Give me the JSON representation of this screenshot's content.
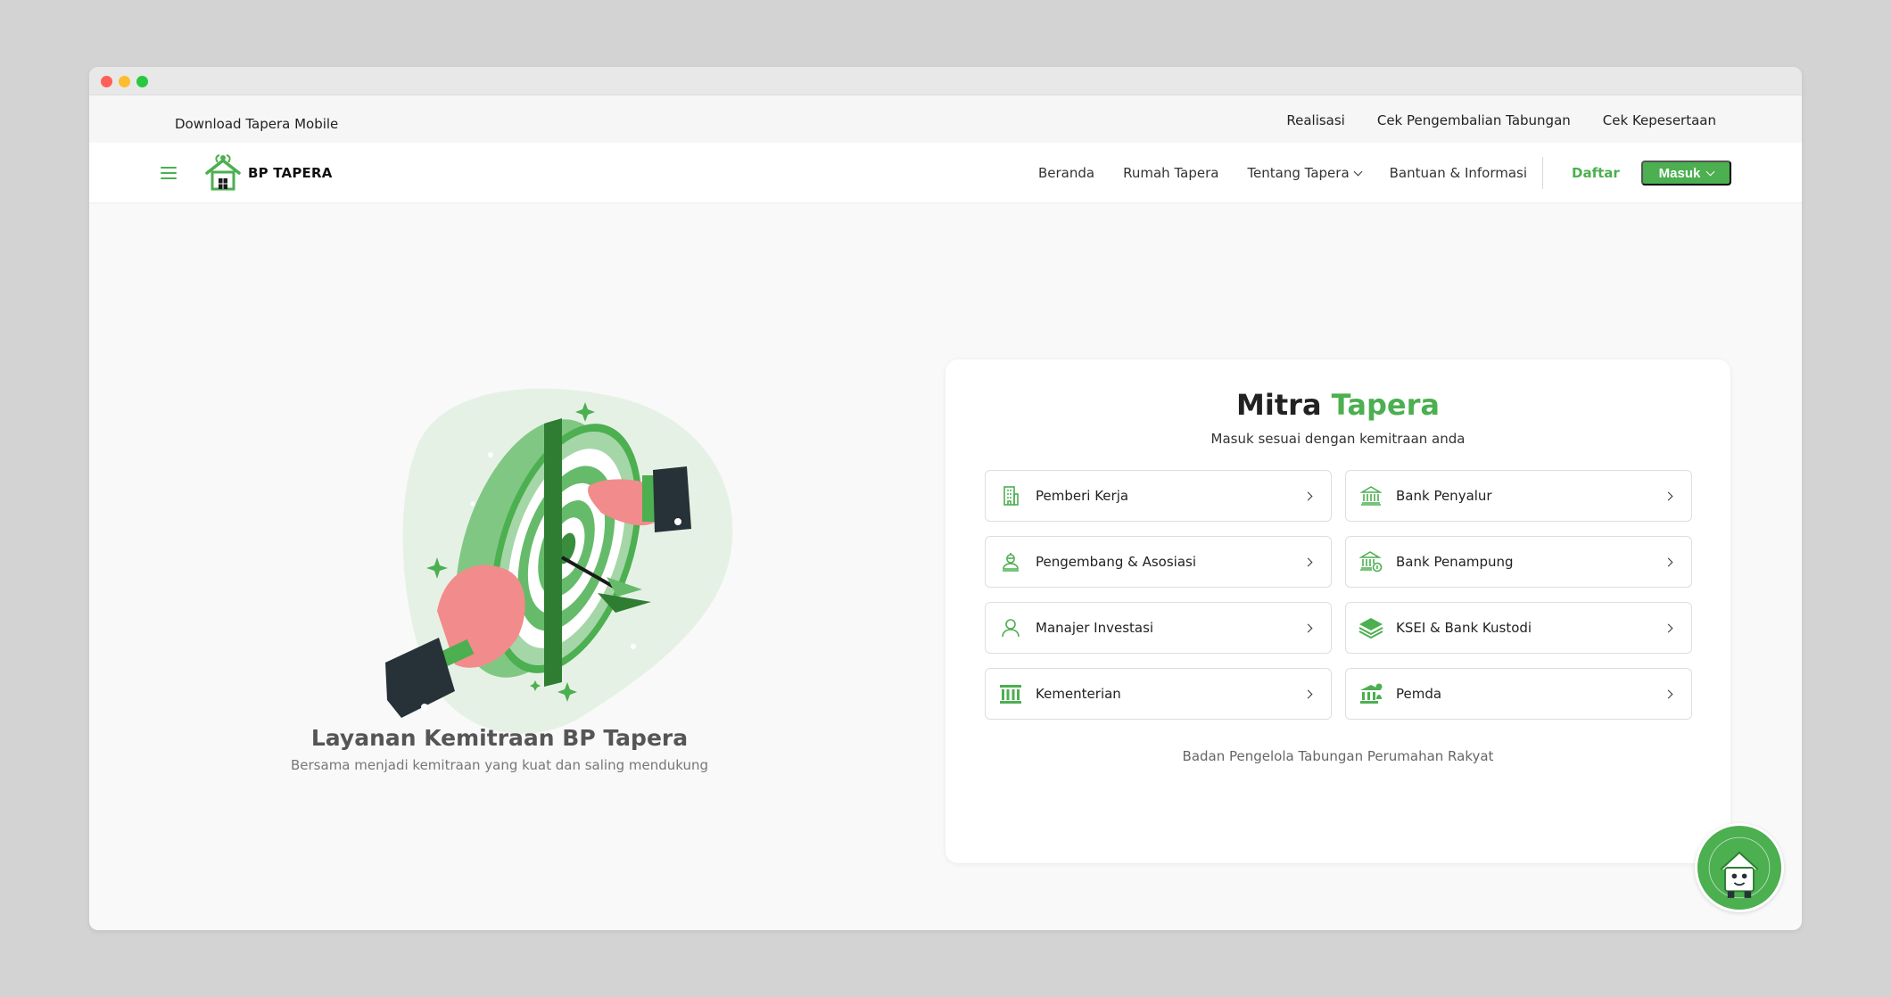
{
  "topbar": {
    "download": "Download Tapera Mobile",
    "links": [
      "Realisasi",
      "Cek Pengembalian Tabungan",
      "Cek Kepesertaan"
    ]
  },
  "navbar": {
    "logo_text": "BP TAPERA",
    "items": [
      "Beranda",
      "Rumah Tapera",
      "Tentang Tapera",
      "Bantuan & Informasi"
    ],
    "register": "Daftar",
    "login": "Masuk"
  },
  "hero": {
    "title": "Layanan Kemitraan BP Tapera",
    "subtitle": "Bersama menjadi kemitraan yang kuat dan saling mendukung"
  },
  "card": {
    "title_part1": "Mitra",
    "title_part2": "Tapera",
    "subtitle": "Masuk sesuai dengan kemitraan anda",
    "items": [
      {
        "label": "Pemberi Kerja",
        "icon": "building-icon"
      },
      {
        "label": "Bank Penyalur",
        "icon": "bank-icon"
      },
      {
        "label": "Pengembang & Asosiasi",
        "icon": "developer-icon"
      },
      {
        "label": "Bank Penampung",
        "icon": "bank-coin-icon"
      },
      {
        "label": "Manajer Investasi",
        "icon": "person-icon"
      },
      {
        "label": "KSEI & Bank Kustodi",
        "icon": "layers-icon"
      },
      {
        "label": "Kementerian",
        "icon": "ministry-icon"
      },
      {
        "label": "Pemda",
        "icon": "gov-icon"
      }
    ],
    "footer": "Badan Pengelola Tabungan Perumahan Rakyat"
  },
  "colors": {
    "brand_green": "#4caf50",
    "dark_green": "#2e7d32",
    "light_green": "#e8f5e9"
  }
}
